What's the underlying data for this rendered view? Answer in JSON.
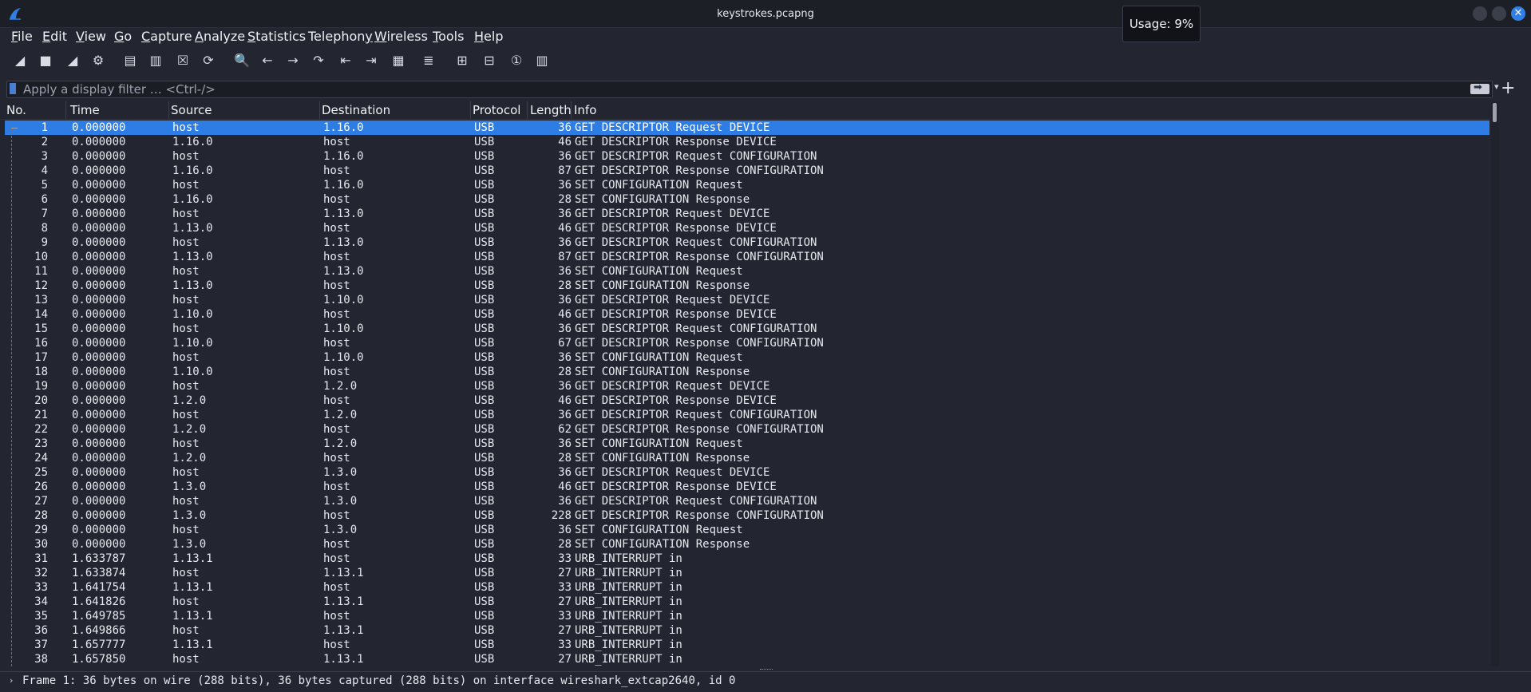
{
  "window": {
    "title": "keystrokes.pcapng",
    "usage": "Usage: 9%",
    "close_glyph": "✕"
  },
  "menu": [
    {
      "label": "File",
      "key": "F",
      "rest": "ile"
    },
    {
      "label": "Edit",
      "key": "E",
      "rest": "dit"
    },
    {
      "label": "View",
      "key": "V",
      "rest": "iew"
    },
    {
      "label": "Go",
      "key": "G",
      "rest": "o"
    },
    {
      "label": "Capture",
      "key": "C",
      "rest": "apture"
    },
    {
      "label": "Analyze",
      "key": "A",
      "rest": "nalyze"
    },
    {
      "label": "Statistics",
      "key": "S",
      "rest": "tatistics"
    },
    {
      "label": "Telephony",
      "key": "y",
      "pre": "Telephon",
      "rest": ""
    },
    {
      "label": "Wireless",
      "key": "W",
      "rest": "ireless"
    },
    {
      "label": "Tools",
      "key": "T",
      "rest": "ools"
    },
    {
      "label": "Help",
      "key": "H",
      "rest": "elp"
    }
  ],
  "toolbar": [
    {
      "name": "start-capture-icon",
      "glyph": "◢"
    },
    {
      "name": "stop-capture-icon",
      "glyph": "■"
    },
    {
      "name": "restart-capture-icon",
      "glyph": "◢"
    },
    {
      "name": "capture-options-icon",
      "glyph": "⚙"
    },
    {
      "name": "open-file-icon",
      "glyph": "▤"
    },
    {
      "name": "save-file-icon",
      "glyph": "▥"
    },
    {
      "name": "close-file-icon",
      "glyph": "☒"
    },
    {
      "name": "reload-file-icon",
      "glyph": "⟳"
    },
    {
      "name": "find-packet-icon",
      "glyph": "🔍"
    },
    {
      "name": "go-back-icon",
      "glyph": "←"
    },
    {
      "name": "go-forward-icon",
      "glyph": "→"
    },
    {
      "name": "go-to-packet-icon",
      "glyph": "↷"
    },
    {
      "name": "go-first-packet-icon",
      "glyph": "⇤"
    },
    {
      "name": "go-last-packet-icon",
      "glyph": "⇥"
    },
    {
      "name": "autoscroll-icon",
      "glyph": "▦"
    },
    {
      "name": "colorize-icon",
      "glyph": "≣"
    },
    {
      "name": "zoom-in-icon",
      "glyph": "⊞"
    },
    {
      "name": "zoom-out-icon",
      "glyph": "⊟"
    },
    {
      "name": "normal-size-icon",
      "glyph": "①"
    },
    {
      "name": "resize-columns-icon",
      "glyph": "▥"
    }
  ],
  "filter": {
    "placeholder": "Apply a display filter … <Ctrl-/>"
  },
  "columns": [
    "No.",
    "Time",
    "Source",
    "Destination",
    "Protocol",
    "Length",
    "Info"
  ],
  "packets": [
    [
      "1",
      "0.000000",
      "host",
      "1.16.0",
      "USB",
      "36",
      "GET DESCRIPTOR Request DEVICE"
    ],
    [
      "2",
      "0.000000",
      "1.16.0",
      "host",
      "USB",
      "46",
      "GET DESCRIPTOR Response DEVICE"
    ],
    [
      "3",
      "0.000000",
      "host",
      "1.16.0",
      "USB",
      "36",
      "GET DESCRIPTOR Request CONFIGURATION"
    ],
    [
      "4",
      "0.000000",
      "1.16.0",
      "host",
      "USB",
      "87",
      "GET DESCRIPTOR Response CONFIGURATION"
    ],
    [
      "5",
      "0.000000",
      "host",
      "1.16.0",
      "USB",
      "36",
      "SET CONFIGURATION Request"
    ],
    [
      "6",
      "0.000000",
      "1.16.0",
      "host",
      "USB",
      "28",
      "SET CONFIGURATION Response"
    ],
    [
      "7",
      "0.000000",
      "host",
      "1.13.0",
      "USB",
      "36",
      "GET DESCRIPTOR Request DEVICE"
    ],
    [
      "8",
      "0.000000",
      "1.13.0",
      "host",
      "USB",
      "46",
      "GET DESCRIPTOR Response DEVICE"
    ],
    [
      "9",
      "0.000000",
      "host",
      "1.13.0",
      "USB",
      "36",
      "GET DESCRIPTOR Request CONFIGURATION"
    ],
    [
      "10",
      "0.000000",
      "1.13.0",
      "host",
      "USB",
      "87",
      "GET DESCRIPTOR Response CONFIGURATION"
    ],
    [
      "11",
      "0.000000",
      "host",
      "1.13.0",
      "USB",
      "36",
      "SET CONFIGURATION Request"
    ],
    [
      "12",
      "0.000000",
      "1.13.0",
      "host",
      "USB",
      "28",
      "SET CONFIGURATION Response"
    ],
    [
      "13",
      "0.000000",
      "host",
      "1.10.0",
      "USB",
      "36",
      "GET DESCRIPTOR Request DEVICE"
    ],
    [
      "14",
      "0.000000",
      "1.10.0",
      "host",
      "USB",
      "46",
      "GET DESCRIPTOR Response DEVICE"
    ],
    [
      "15",
      "0.000000",
      "host",
      "1.10.0",
      "USB",
      "36",
      "GET DESCRIPTOR Request CONFIGURATION"
    ],
    [
      "16",
      "0.000000",
      "1.10.0",
      "host",
      "USB",
      "67",
      "GET DESCRIPTOR Response CONFIGURATION"
    ],
    [
      "17",
      "0.000000",
      "host",
      "1.10.0",
      "USB",
      "36",
      "SET CONFIGURATION Request"
    ],
    [
      "18",
      "0.000000",
      "1.10.0",
      "host",
      "USB",
      "28",
      "SET CONFIGURATION Response"
    ],
    [
      "19",
      "0.000000",
      "host",
      "1.2.0",
      "USB",
      "36",
      "GET DESCRIPTOR Request DEVICE"
    ],
    [
      "20",
      "0.000000",
      "1.2.0",
      "host",
      "USB",
      "46",
      "GET DESCRIPTOR Response DEVICE"
    ],
    [
      "21",
      "0.000000",
      "host",
      "1.2.0",
      "USB",
      "36",
      "GET DESCRIPTOR Request CONFIGURATION"
    ],
    [
      "22",
      "0.000000",
      "1.2.0",
      "host",
      "USB",
      "62",
      "GET DESCRIPTOR Response CONFIGURATION"
    ],
    [
      "23",
      "0.000000",
      "host",
      "1.2.0",
      "USB",
      "36",
      "SET CONFIGURATION Request"
    ],
    [
      "24",
      "0.000000",
      "1.2.0",
      "host",
      "USB",
      "28",
      "SET CONFIGURATION Response"
    ],
    [
      "25",
      "0.000000",
      "host",
      "1.3.0",
      "USB",
      "36",
      "GET DESCRIPTOR Request DEVICE"
    ],
    [
      "26",
      "0.000000",
      "1.3.0",
      "host",
      "USB",
      "46",
      "GET DESCRIPTOR Response DEVICE"
    ],
    [
      "27",
      "0.000000",
      "host",
      "1.3.0",
      "USB",
      "36",
      "GET DESCRIPTOR Request CONFIGURATION"
    ],
    [
      "28",
      "0.000000",
      "1.3.0",
      "host",
      "USB",
      "228",
      "GET DESCRIPTOR Response CONFIGURATION"
    ],
    [
      "29",
      "0.000000",
      "host",
      "1.3.0",
      "USB",
      "36",
      "SET CONFIGURATION Request"
    ],
    [
      "30",
      "0.000000",
      "1.3.0",
      "host",
      "USB",
      "28",
      "SET CONFIGURATION Response"
    ],
    [
      "31",
      "1.633787",
      "1.13.1",
      "host",
      "USB",
      "33",
      "URB_INTERRUPT in"
    ],
    [
      "32",
      "1.633874",
      "host",
      "1.13.1",
      "USB",
      "27",
      "URB_INTERRUPT in"
    ],
    [
      "33",
      "1.641754",
      "1.13.1",
      "host",
      "USB",
      "33",
      "URB_INTERRUPT in"
    ],
    [
      "34",
      "1.641826",
      "host",
      "1.13.1",
      "USB",
      "27",
      "URB_INTERRUPT in"
    ],
    [
      "35",
      "1.649785",
      "1.13.1",
      "host",
      "USB",
      "33",
      "URB_INTERRUPT in"
    ],
    [
      "36",
      "1.649866",
      "host",
      "1.13.1",
      "USB",
      "27",
      "URB_INTERRUPT in"
    ],
    [
      "37",
      "1.657777",
      "1.13.1",
      "host",
      "USB",
      "33",
      "URB_INTERRUPT in"
    ],
    [
      "38",
      "1.657850",
      "host",
      "1.13.1",
      "USB",
      "27",
      "URB_INTERRUPT in"
    ]
  ],
  "selected_packet": "1",
  "details": {
    "toggle": "›",
    "text": "Frame 1: 36 bytes on wire (288 bits), 36 bytes captured (288 bits) on interface wireshark_extcap2640, id 0"
  },
  "colors": {
    "selection": "#2d7de4",
    "background": "#232630"
  }
}
